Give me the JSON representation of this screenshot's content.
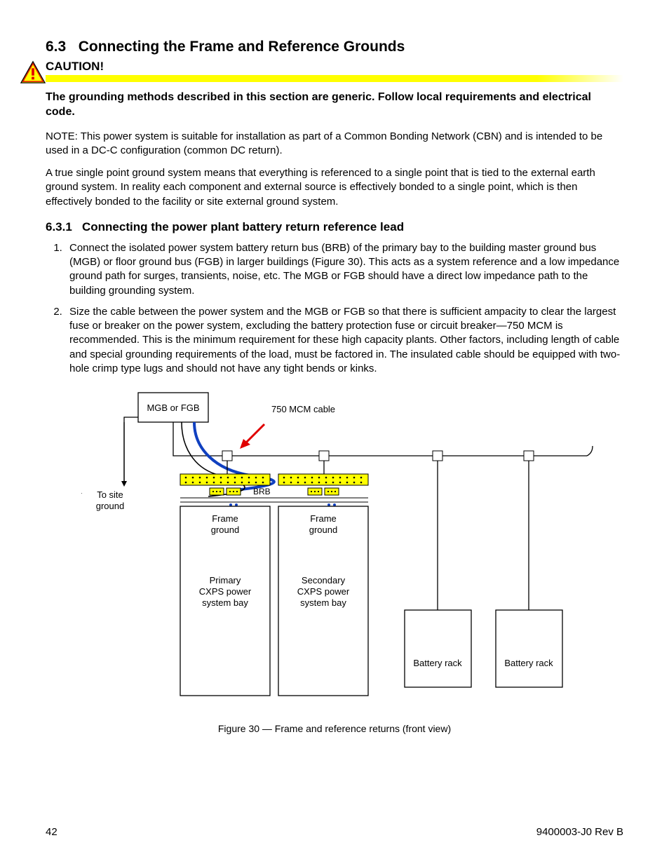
{
  "section_number": "6.3",
  "section_title": "Connecting the Frame and Reference Grounds",
  "caution_label": "CAUTION!",
  "bold_statement": "The grounding methods described in this section are generic. Follow local requirements and electrical code.",
  "note_text": "NOTE: This power system is suitable for installation as part of a Common Bonding Network (CBN) and is intended to be used in a DC-C configuration (common DC return).",
  "para2": "A true single point ground system means that everything is referenced to a single point that is tied to the external earth ground system. In reality each component and external source is effectively bonded to a single point, which is then effectively bonded to the facility or site external ground system.",
  "subsection_number": "6.3.1",
  "subsection_title": "Connecting the power plant battery return reference lead",
  "list": [
    "Connect the isolated power system battery return bus (BRB) of the primary bay to the building master ground bus (MGB) or floor ground bus (FGB) in larger buildings (Figure 30). This acts as a system reference and a low impedance ground path for surges, transients, noise, etc. The MGB or FGB should have a direct low impedance path to the building grounding system.",
    "Size the cable between the power system and the MGB or FGB so that there is sufficient ampacity to clear the largest fuse or breaker on the power system, excluding the battery protection fuse or circuit breaker—750 MCM is recommended. This is the minimum requirement for these high capacity plants. Other factors, including length of cable and special grounding requirements of the load, must be factored in. The insulated cable should be equipped with two-hole crimp type lugs and should not have any tight bends or kinks."
  ],
  "figure": {
    "mgb_label": "MGB or FGB",
    "cable_label": "750 MCM cable",
    "to_site": "To site ground",
    "brb_label": "BRB",
    "frame_ground": "Frame ground",
    "primary_bay_l1": "Primary",
    "primary_bay_l2": "CXPS power",
    "primary_bay_l3": "system bay",
    "secondary_bay_l1": "Secondary",
    "secondary_bay_l2": "CXPS power",
    "secondary_bay_l3": "system bay",
    "battery_rack": "Battery rack",
    "caption": "Figure 30 — Frame and reference returns (front view)"
  },
  "footer": {
    "page": "42",
    "docref": "9400003-J0   Rev B"
  }
}
